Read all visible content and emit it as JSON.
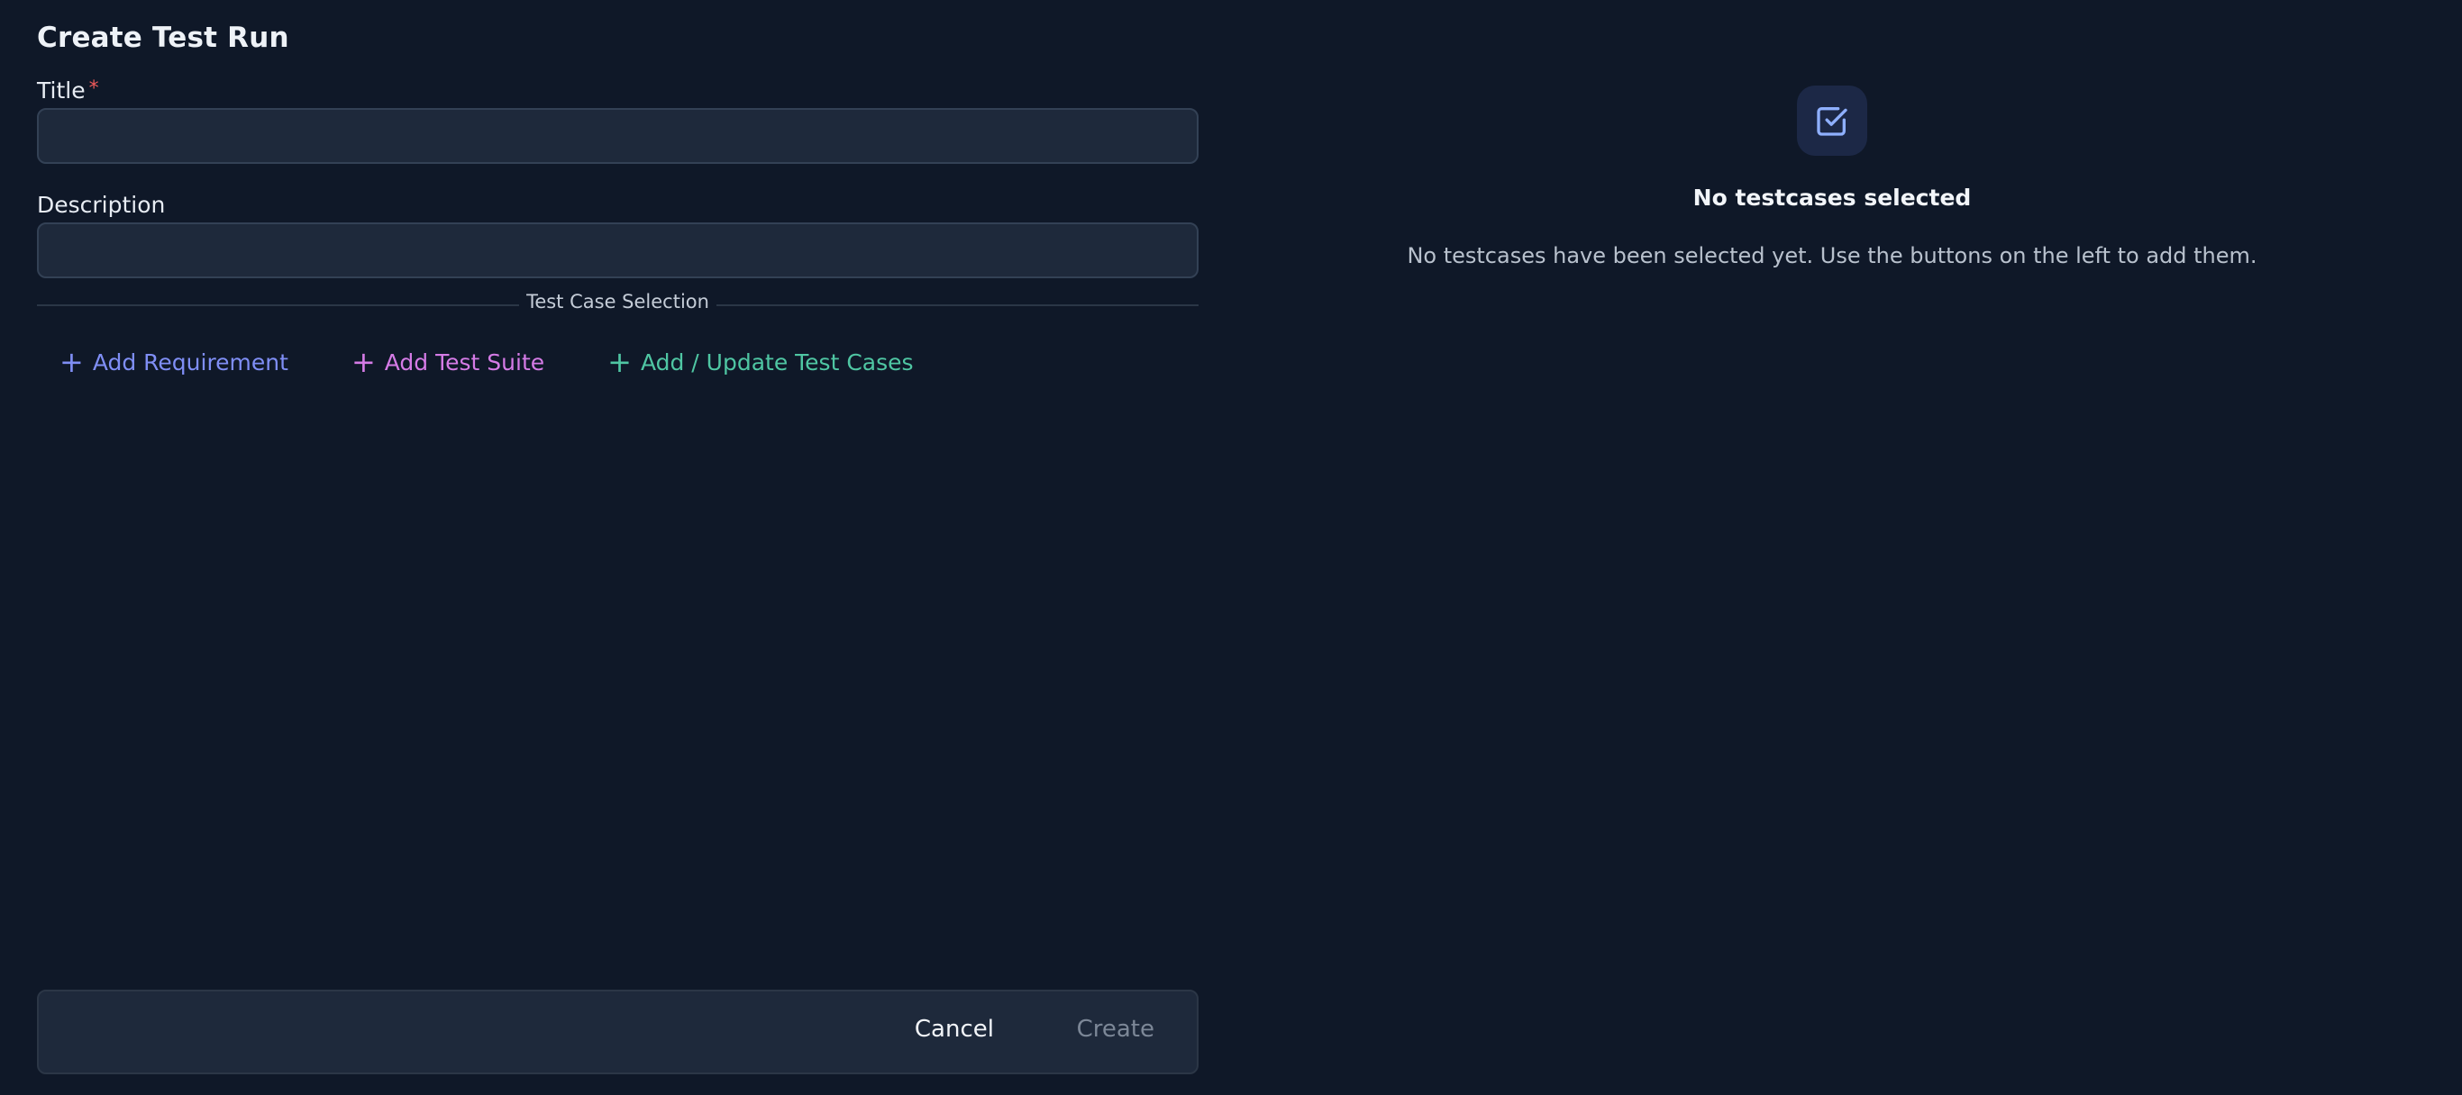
{
  "dialog": {
    "title": "Create Test Run"
  },
  "form": {
    "title_label": "Title",
    "required_marker": "*",
    "title_value": "",
    "description_label": "Description",
    "description_value": ""
  },
  "selection": {
    "divider_label": "Test Case Selection",
    "actions": [
      {
        "label": "Add Requirement",
        "icon": "plus-icon",
        "color": "#7f8ef5"
      },
      {
        "label": "Add Test Suite",
        "icon": "plus-icon",
        "color": "#d57be6"
      },
      {
        "label": "Add / Update Test Cases",
        "icon": "plus-icon",
        "color": "#4fc6a3"
      }
    ]
  },
  "footer": {
    "cancel_label": "Cancel",
    "create_label": "Create"
  },
  "empty_state": {
    "icon": "checkbox-check-icon",
    "title": "No testcases selected",
    "description": "No testcases have been selected yet. Use the buttons on the left to add them."
  },
  "colors": {
    "background": "#0f1828",
    "input_bg": "#1e293b",
    "required": "#ef5a5a",
    "icon_accent": "#8fb0ff"
  }
}
